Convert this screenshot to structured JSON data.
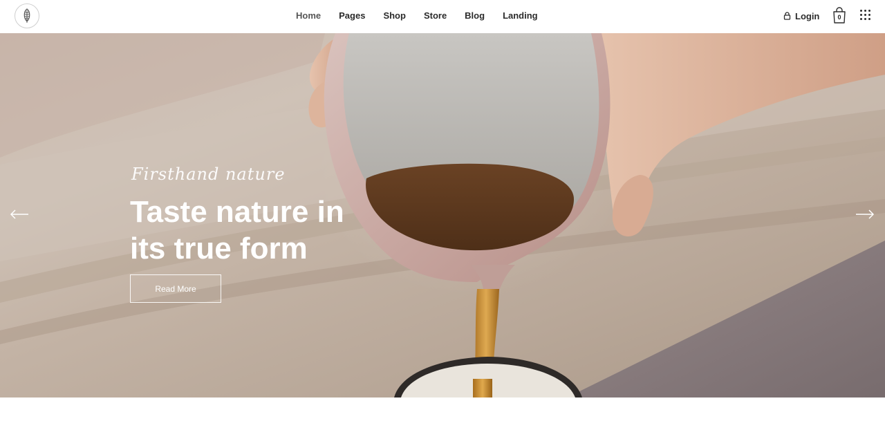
{
  "header": {
    "logo_icon": "leaf-icon",
    "nav": [
      {
        "label": "Home",
        "active": true
      },
      {
        "label": "Pages",
        "active": false
      },
      {
        "label": "Shop",
        "active": false
      },
      {
        "label": "Store",
        "active": false
      },
      {
        "label": "Blog",
        "active": false
      },
      {
        "label": "Landing",
        "active": false
      }
    ],
    "login_label": "Login",
    "cart_count": "0"
  },
  "hero": {
    "eyebrow": "Firsthand nature",
    "title_line1": "Taste nature in",
    "title_line2": "its true form",
    "button_label": "Read More"
  },
  "colors": {
    "text_dark": "#2b2b2b",
    "nav_active_bg": "#e3e8df",
    "hero_text": "#ffffff",
    "tea": "#6b3f1e"
  }
}
